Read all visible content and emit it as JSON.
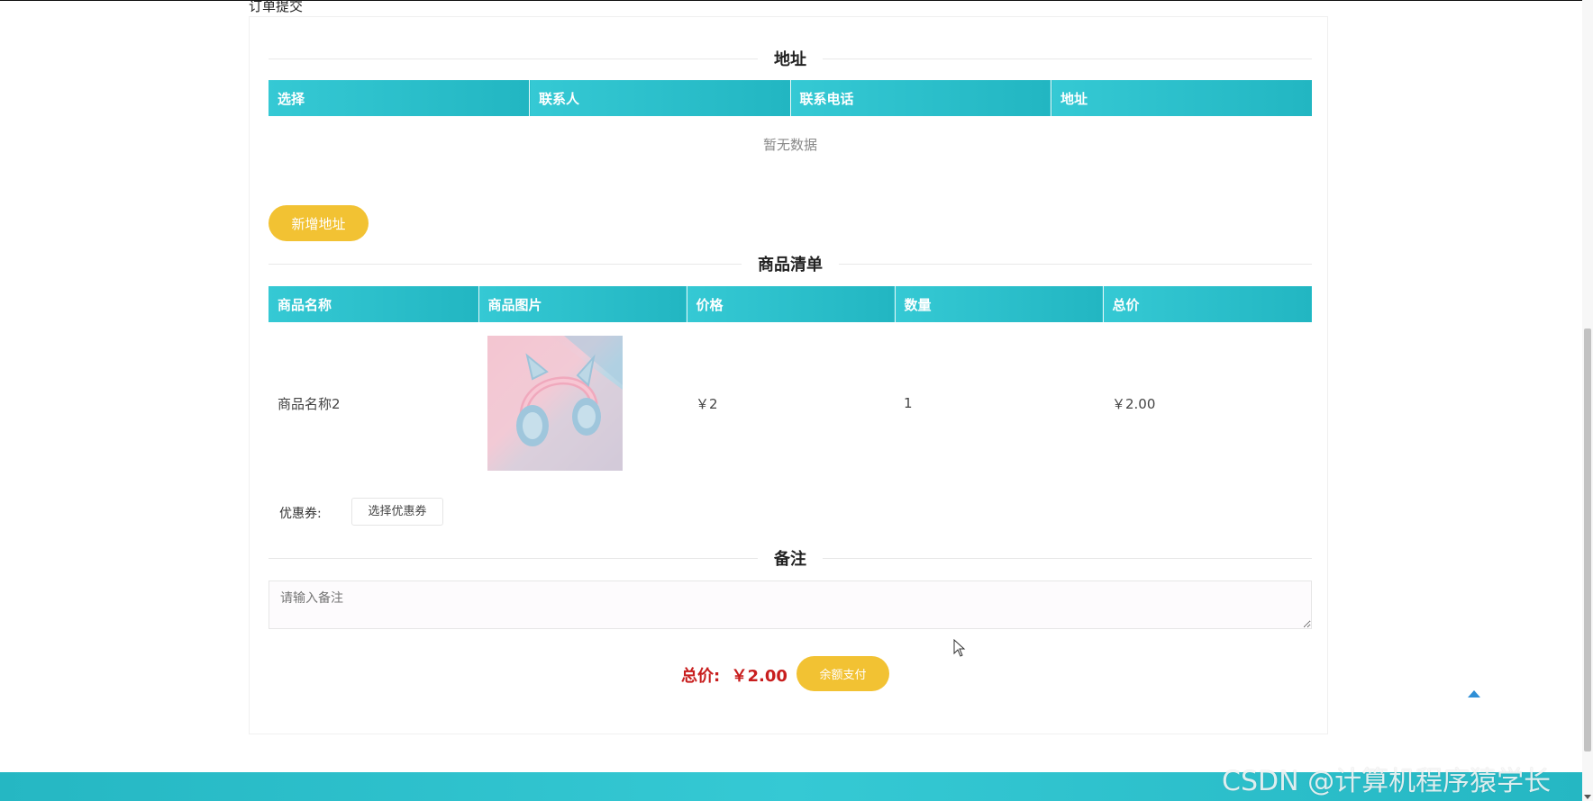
{
  "header": {
    "title": "订单提交"
  },
  "address_section": {
    "title": "地址",
    "columns": [
      "选择",
      "联系人",
      "联系电话",
      "地址"
    ],
    "empty_text": "暂无数据",
    "add_button": "新增地址"
  },
  "goods_section": {
    "title": "商品清单",
    "columns": [
      "商品名称",
      "商品图片",
      "价格",
      "数量",
      "总价"
    ],
    "rows": [
      {
        "name": "商品名称2",
        "image": "headphones-product-image",
        "price": "￥2",
        "quantity": "1",
        "total": "￥2.00"
      }
    ]
  },
  "coupon": {
    "label": "优惠券:",
    "button": "选择优惠券"
  },
  "remark_section": {
    "title": "备注",
    "placeholder": "请输入备注"
  },
  "summary": {
    "total_label": "总价:",
    "total_value": "￥2.00",
    "pay_button": "余额支付"
  },
  "watermark": "CSDN @计算机程序猿学长",
  "colors": {
    "table_header": "#2dc0cc",
    "accent_yellow": "#f2c233",
    "total_red": "#c81e1e",
    "footer": "#25b7c3"
  }
}
